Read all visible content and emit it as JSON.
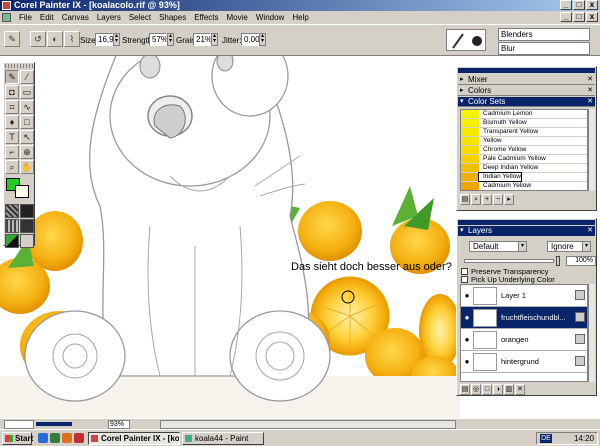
{
  "window": {
    "title": "Corel Painter IX - [koalacolo.rif @ 93%]",
    "minimize": "_",
    "maximize": "□",
    "close": "x"
  },
  "menu": {
    "items": [
      "File",
      "Edit",
      "Canvas",
      "Layers",
      "Select",
      "Shapes",
      "Effects",
      "Movie",
      "Window",
      "Help"
    ]
  },
  "propbar": {
    "size_label": "Size:",
    "size_value": "16,9",
    "strength_label": "Strength:",
    "strength_value": "57%",
    "grain_label": "Grain:",
    "grain_value": "21%",
    "jitter_label": "Jitter:",
    "jitter_value": "0,00",
    "brush_category": "Blenders",
    "brush_variant": "Blur"
  },
  "canvas": {
    "speech_text": "Das sieht doch besser aus oder?"
  },
  "palettes": {
    "mixer": "Mixer",
    "colors": "Colors",
    "color_sets": "Color Sets",
    "color_set_items": [
      {
        "name": "Cadmium Lemon",
        "color": "#f4f400"
      },
      {
        "name": "Bismuth Yellow",
        "color": "#f6ef00"
      },
      {
        "name": "Transparent Yellow",
        "color": "#f4ea00"
      },
      {
        "name": "Yellow",
        "color": "#f2e400"
      },
      {
        "name": "Chrome Yellow",
        "color": "#f7dc00"
      },
      {
        "name": "Pale Cadmium Yellow",
        "color": "#f7d200"
      },
      {
        "name": "Deep Indian Yellow",
        "color": "#f2bf00"
      },
      {
        "name": "Indian Yellow",
        "color": "#efb100"
      },
      {
        "name": "Cadmium Yellow",
        "color": "#eca800"
      }
    ],
    "selected_color_index": 7
  },
  "layers": {
    "title": "Layers",
    "composite_method": "Default",
    "depth_method": "Ignore",
    "opacity": "100%",
    "preserve_transparency": "Preserve Transparency",
    "pick_up_underlying": "Pick Up Underlying Color",
    "items": [
      {
        "name": "Layer 1",
        "selected": false
      },
      {
        "name": "fruchtfleischundbl...",
        "selected": true
      },
      {
        "name": "orangen",
        "selected": false
      },
      {
        "name": "hintergrund",
        "selected": false
      }
    ]
  },
  "statusbar": {
    "zoom": "93%"
  },
  "taskbar": {
    "start": "Start",
    "tasks": [
      {
        "label": "Corel Painter IX - [ko...",
        "active": true
      },
      {
        "label": "koala44 - Paint",
        "active": false
      }
    ],
    "lang": "DE",
    "time": "14:20"
  }
}
